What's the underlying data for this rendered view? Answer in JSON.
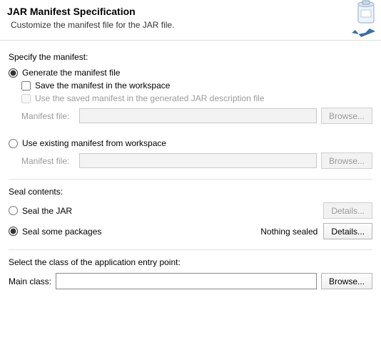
{
  "header": {
    "title": "JAR Manifest Specification",
    "subtitle": "Customize the manifest file for the JAR file."
  },
  "manifest": {
    "section_label": "Specify the manifest:",
    "generate": {
      "label": "Generate the manifest file",
      "checked": true,
      "save_label": "Save the manifest in the workspace",
      "save_checked": false,
      "reuse_label": "Use the saved manifest in the generated JAR description file",
      "file_label": "Manifest file:",
      "file_value": "",
      "browse_label": "Browse..."
    },
    "existing": {
      "label": "Use existing manifest from workspace",
      "checked": false,
      "file_label": "Manifest file:",
      "file_value": "",
      "browse_label": "Browse..."
    }
  },
  "seal": {
    "section_label": "Seal contents:",
    "jar": {
      "label": "Seal the JAR",
      "checked": false,
      "details_label": "Details..."
    },
    "some": {
      "label": "Seal some packages",
      "checked": true,
      "status": "Nothing sealed",
      "details_label": "Details..."
    }
  },
  "entry": {
    "section_label": "Select the class of the application entry point:",
    "main_label": "Main class:",
    "main_value": "",
    "browse_label": "Browse..."
  }
}
